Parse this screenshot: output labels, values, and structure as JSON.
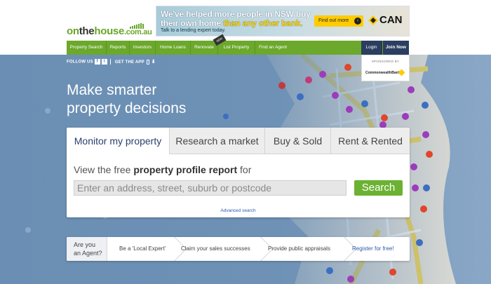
{
  "logo": {
    "on": "on",
    "the": "the",
    "house": "house",
    "dom": ".com.au"
  },
  "banner": {
    "line1": "We've helped more people in NSW buy",
    "line2a": "their own home ",
    "line2b": "than any other bank.",
    "line3": "Talk to a lending expert today.",
    "cta": "Find out more",
    "brand": "CAN"
  },
  "nav": {
    "items": [
      "Property Search",
      "Reports",
      "Investors",
      "Home Loans",
      "Renovate",
      "List Property",
      "Find an Agent"
    ],
    "new_badge": "NEW",
    "login": "Login",
    "join": "Join Now"
  },
  "social": {
    "follow": "FOLLOW US",
    "getapp": "GET THE APP"
  },
  "sponsor": {
    "label": "SPONSORED BY",
    "brand": "CommonwealthBank"
  },
  "hero": {
    "line1": "Make smarter",
    "line2": "property decisions"
  },
  "tabs": [
    "Monitor my property",
    "Research a market",
    "Buy & Sold",
    "Rent & Rented"
  ],
  "search": {
    "prefix": "View the free ",
    "bold": "property profile report",
    "suffix": " for",
    "placeholder": "Enter an address, street, suburb or postcode",
    "button": "Search",
    "advanced": "Advanced search"
  },
  "agent": {
    "question1": "Are you",
    "question2": "an Agent?",
    "steps": [
      "Be a 'Local Expert'",
      "Claim your sales successes",
      "Provide public appraisals"
    ],
    "register": "Register for free!"
  }
}
